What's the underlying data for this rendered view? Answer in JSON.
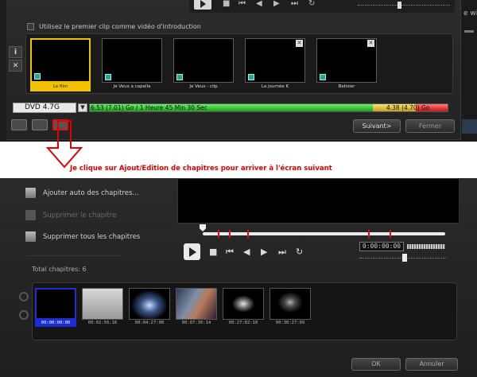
{
  "top_panel": {
    "intro_checkbox_label": "Utilisez le premier clip comme vidéo d'introduction",
    "side_tools": {
      "info": "i",
      "delete": "✕"
    },
    "clips": [
      {
        "label": "Le film",
        "selected": true
      },
      {
        "label": "Je Veux a capella",
        "selected": false
      },
      {
        "label": "Je Veux - clip",
        "selected": false
      },
      {
        "label": "La journée K",
        "selected": false
      },
      {
        "label": "Betisier",
        "selected": false
      }
    ],
    "disc_select": "DVD 4.7G",
    "usage_text": "6.53 (7.01) Go / 1 Heure 45 Min 30 Sec",
    "capacity_text": "4.38 (4.70) Go",
    "progress": {
      "used_fraction": 0.79,
      "warning_fraction": 0.12,
      "over_fraction": 0.09
    },
    "next_button": "Suivant>",
    "close_button": "Fermer",
    "right_edge_text": "e win"
  },
  "annotation": {
    "text": "Je clique sur Ajout/Edition de chapitres pour arriver à l'écran suivant",
    "color": "#e00000"
  },
  "bottom_panel": {
    "menu": {
      "auto_add": "Ajouter auto des chapitres...",
      "delete_chapter": "Supprimer le chapitre",
      "delete_all": "Supprimer tous les chapitres"
    },
    "total_label": "Total chapitres:",
    "total_value": "6",
    "timecode": "0:00:00:00",
    "chapters": [
      {
        "time": "00:00:00:00",
        "selected": true
      },
      {
        "time": "00:02:56:16",
        "selected": false
      },
      {
        "time": "00:04:27:00",
        "selected": false
      },
      {
        "time": "00:07:30:14",
        "selected": false
      },
      {
        "time": "00:27:02:10",
        "selected": false
      },
      {
        "time": "00:30:27:09",
        "selected": false
      }
    ],
    "ok_button": "OK",
    "cancel_button": "Annuler"
  },
  "icons": [
    "play-icon",
    "stop-icon",
    "skip-start-icon",
    "step-back-icon",
    "step-forward-icon",
    "skip-end-icon",
    "repeat-icon",
    "undo-icon",
    "redo-icon"
  ]
}
